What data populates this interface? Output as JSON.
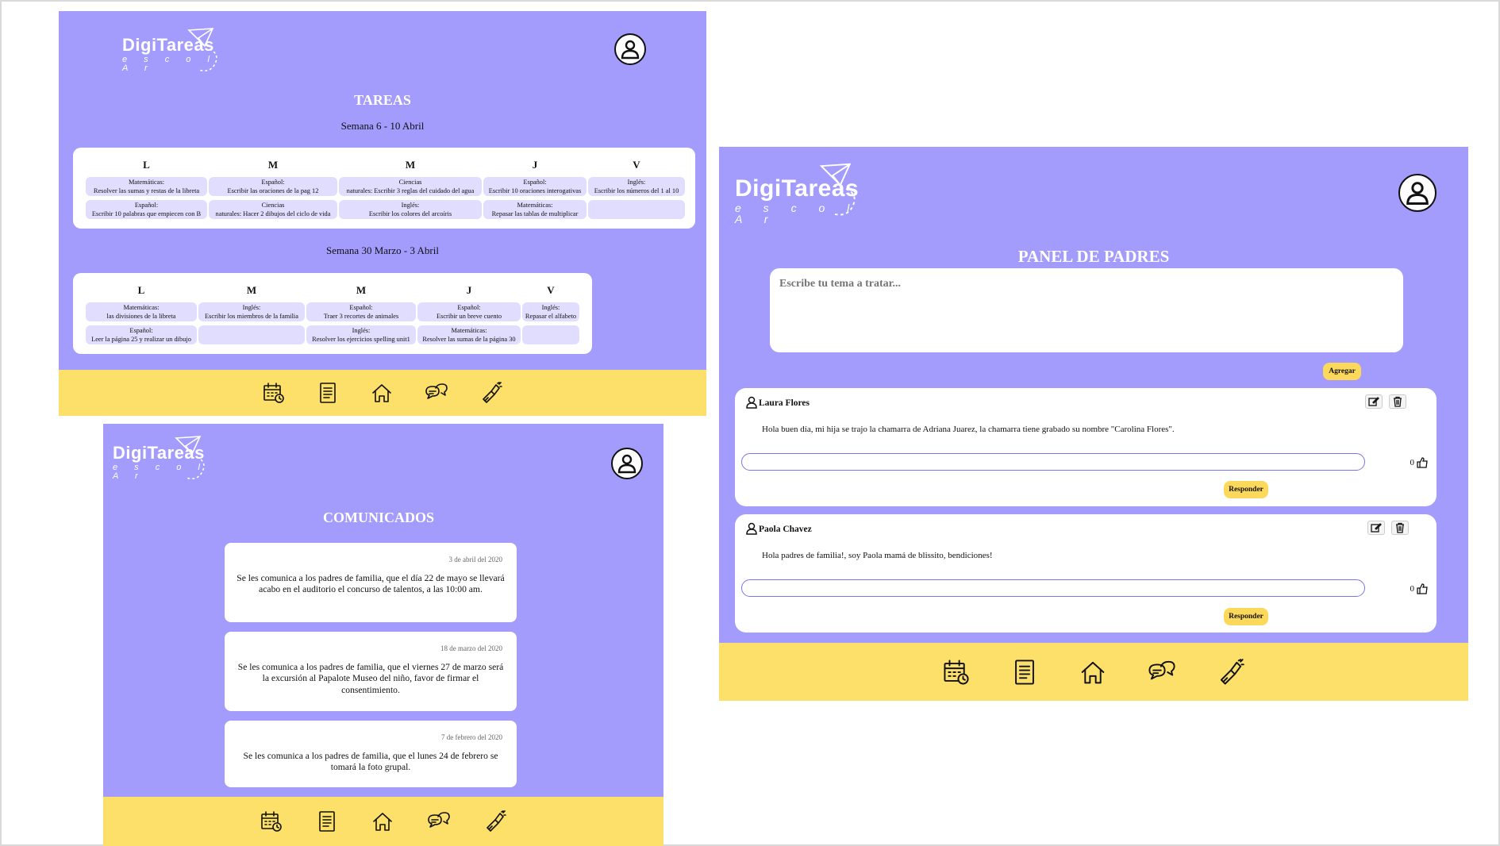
{
  "brand": {
    "name": "DigiTareas",
    "sub": "e s c o l A r"
  },
  "nav_icons": [
    "calendar-clock-icon",
    "document-list-icon",
    "home-icon",
    "chat-bubbles-icon",
    "megaphone-icon"
  ],
  "colors": {
    "panel": "#a39cfd",
    "navbar": "#fde06a",
    "button": "#fdd95b",
    "task_cell": "#e1ddfe"
  },
  "tareas": {
    "title": "TAREAS",
    "weeks": [
      {
        "label": "Semana 6 - 10 Abril",
        "days": [
          "L",
          "M",
          "M",
          "J",
          "V"
        ],
        "rows": [
          [
            {
              "subject": "Matemáticas:",
              "task": "Resolver las sumas y restas de la libreta"
            },
            {
              "subject": "Español:",
              "task": "Escribir las oraciones de la pag 12"
            },
            {
              "subject": "Ciencias",
              "task": "naturales: Escribir 3 reglas del cuidado del agua"
            },
            {
              "subject": "Español:",
              "task": "Escribir 10 oraciones interogativas"
            },
            {
              "subject": "Inglés:",
              "task": "Escribir los números del 1 al 10"
            }
          ],
          [
            {
              "subject": "Español:",
              "task": "Escribir 10 palabras que empiecen con B"
            },
            {
              "subject": "Ciencias",
              "task": "naturales: Hacer 2 dibujos del ciclo de vida"
            },
            {
              "subject": "Inglés:",
              "task": "Escribir los colores del arcoíris"
            },
            {
              "subject": "Matemáticas:",
              "task": "Repasar las tablas de multiplicar"
            },
            {
              "subject": "",
              "task": ""
            }
          ]
        ]
      },
      {
        "label": "Semana 30 Marzo - 3 Abril",
        "days": [
          "L",
          "M",
          "M",
          "J",
          "V"
        ],
        "rows": [
          [
            {
              "subject": "Matemáticas:",
              "task": "las divisiones de la libreta"
            },
            {
              "subject": "Inglés:",
              "task": "Escribir los miembros de la familia"
            },
            {
              "subject": "Español:",
              "task": "Traer 3 recortes de animales"
            },
            {
              "subject": "Español:",
              "task": "Escribir un breve cuento"
            },
            {
              "subject": "Inglés:",
              "task": "Repasar el alfabeto"
            }
          ],
          [
            {
              "subject": "Español:",
              "task": "Leer la página 25 y realizar un dibujo"
            },
            {
              "subject": "",
              "task": ""
            },
            {
              "subject": "Inglés:",
              "task": "Resolver los ejercicios spelling unit1"
            },
            {
              "subject": "Matemáticas:",
              "task": "Resolver las sumas de la página 30"
            },
            {
              "subject": "",
              "task": ""
            }
          ]
        ]
      }
    ]
  },
  "comunicados": {
    "title": "COMUNICADOS",
    "items": [
      {
        "date": "3 de abril del 2020",
        "text": "Se les comunica a los padres de familia, que el día 22 de mayo se llevará acabo en el auditorio el concurso de talentos, a las 10:00 am."
      },
      {
        "date": "18 de marzo del 2020",
        "text": "Se les comunica a los padres de familia, que el viernes 27 de marzo será la excursión al Papalote Museo del niño, favor de firmar el consentimiento."
      },
      {
        "date": "7 de febrero del 2020",
        "text": "Se les comunica a los padres de familia, que el lunes 24 de febrero se tomará la foto grupal."
      }
    ]
  },
  "padres": {
    "title": "PANEL DE PADRES",
    "topic_placeholder": "Escribe tu tema a tratar...",
    "add_label": "Agregar",
    "posts": [
      {
        "author": "Laura Flores",
        "message": "Hola buen día, mi hija se trajo la chamarra de Adriana Juarez, la chamarra tiene grabado su nombre \"Carolina Flores\".",
        "likes": "0",
        "reply_label": "Responder"
      },
      {
        "author": "Paola Chavez",
        "message": "Hola padres de familia!, soy Paola mamá de blissito, bendiciones!",
        "likes": "0",
        "reply_label": "Responder"
      }
    ]
  }
}
